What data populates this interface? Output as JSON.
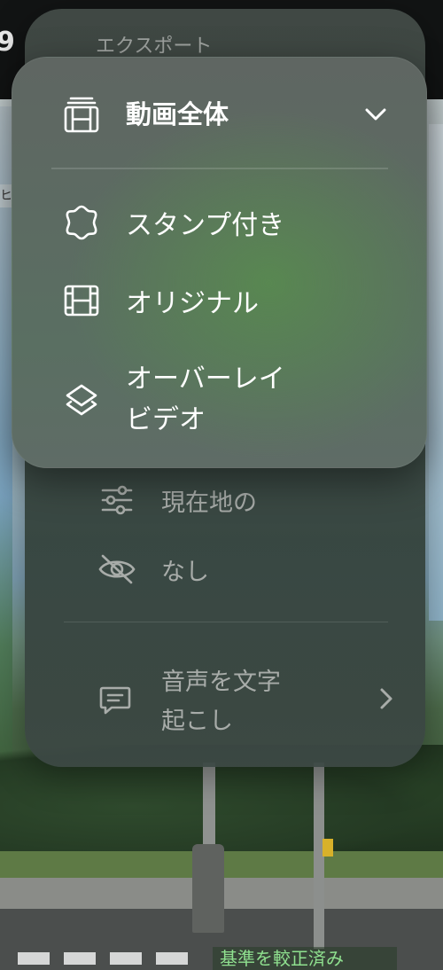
{
  "background": {
    "top_left_text": "9",
    "left_tag_text": "ヒ",
    "calibration_label": "基準を較正済み"
  },
  "back_menu": {
    "title": "エクスポート",
    "items": [
      {
        "label": "現在地の",
        "icon": "sliders-icon"
      },
      {
        "label": "なし",
        "icon": "eye-slash-icon"
      }
    ],
    "transcribe": {
      "label": "音声を文字\n起こし",
      "icon": "speech-bubble-icon",
      "has_chevron": true
    }
  },
  "front_menu": {
    "header": {
      "label": "動画全体",
      "icon": "film-stack-icon",
      "chevron": "chevron-down-icon"
    },
    "options": [
      {
        "label": "スタンプ付き",
        "icon": "stamp-seal-icon"
      },
      {
        "label": "オリジナル",
        "icon": "film-icon"
      },
      {
        "label": "オーバーレイ\nビデオ",
        "icon": "layers-icon"
      }
    ]
  },
  "colors": {
    "menu_text": "#ffffff",
    "dim_text": "#a8aca9",
    "calibration_text": "#8fe08f"
  }
}
